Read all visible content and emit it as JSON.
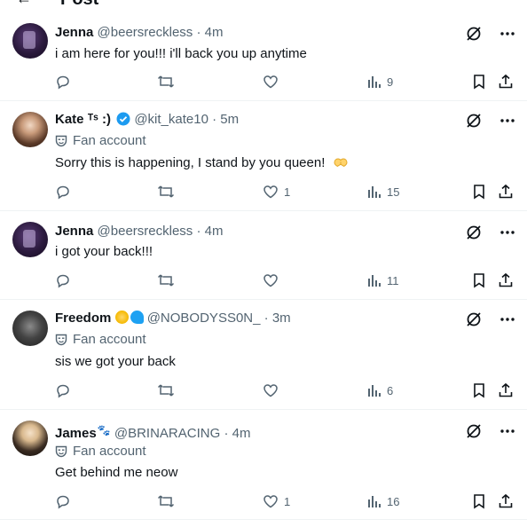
{
  "header": {
    "back_icon": "arrow-left-icon",
    "title": "Post"
  },
  "colors": {
    "text": "#0f1419",
    "muted": "#536471",
    "verified": "#1d9bf0",
    "divider": "#eff3f4"
  },
  "replies": [
    {
      "name": "Jenna",
      "handle": "@beersreckless",
      "dot": "·",
      "time": "4m",
      "fan": "",
      "text": "i am here for you!!! i'll back you up anytime",
      "likes": "",
      "views": "9"
    },
    {
      "name": "Kate",
      "name_suffix": "ᵀˢ :)",
      "handle": "@kit_kate10",
      "dot": "·",
      "time": "5m",
      "fan": "Fan account",
      "text": "Sorry this is happening, I stand by you queen!",
      "likes": "1",
      "views": "15"
    },
    {
      "name": "Jenna",
      "handle": "@beersreckless",
      "dot": "·",
      "time": "4m",
      "fan": "",
      "text": "i got your back!!!",
      "likes": "",
      "views": "11"
    },
    {
      "name": "Freedom",
      "handle": "@NOBODYSS0N_",
      "dot": "·",
      "time": "3m",
      "fan": "Fan account",
      "text": "sis we got your back",
      "likes": "",
      "views": "6"
    },
    {
      "name": "James",
      "handle": "@BRINARACING",
      "dot": "·",
      "time": "4m",
      "fan": "Fan account",
      "text": "Get behind me neow",
      "likes": "1",
      "views": "16"
    }
  ]
}
